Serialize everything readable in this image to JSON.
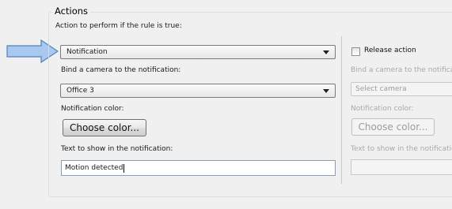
{
  "actions": {
    "group_title": "Actions",
    "action_label": "Action to perform if the rule is true:",
    "action_selected": "Notification",
    "bind_camera_label": "Bind a camera to the notification:",
    "camera_selected": "Office 3",
    "color_label": "Notification color:",
    "choose_color_button": "Choose color...",
    "text_label": "Text to show in the notification:",
    "text_value": "Motion detected"
  },
  "release": {
    "checkbox_label": "Release action",
    "bind_camera_label": "Bind a camera to the notification:",
    "camera_placeholder": "Select camera",
    "color_label": "Notification color:",
    "choose_color_button": "Choose color...",
    "text_label": "Text to show in the notification:",
    "text_value": ""
  },
  "colors": {
    "pointer_arrow": "#a8c8f0",
    "pointer_arrow_border": "#4f81bd"
  },
  "icons": {
    "pointer": "right-arrow-icon",
    "dropdown": "chevron-down-icon"
  }
}
